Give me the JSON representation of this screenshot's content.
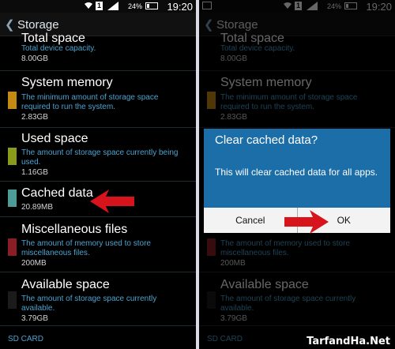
{
  "status": {
    "battery_pct": "24%",
    "time": "19:20",
    "sim": "1"
  },
  "actionbar": {
    "title": "Storage"
  },
  "items": [
    {
      "title": "Total space",
      "desc": "Total device capacity.",
      "value": "8.00GB",
      "color": ""
    },
    {
      "title": "System memory",
      "desc": "The minimum amount of storage space required to run the system.",
      "value": "2.83GB",
      "color": "#c58a12"
    },
    {
      "title": "Used space",
      "desc": "The amount of storage space currently being used.",
      "value": "1.16GB",
      "color": "#8a9a1b"
    },
    {
      "title": "Cached data",
      "desc": "",
      "value": "20.89MB",
      "color": "#4d9c97"
    },
    {
      "title": "Miscellaneous files",
      "desc": "The amount of memory used to store miscellaneous files.",
      "value": "200MB",
      "color": "#8a1e24"
    },
    {
      "title": "Available space",
      "desc": "The amount of storage space currently available.",
      "value": "3.79GB",
      "color": "#1b1b1b"
    }
  ],
  "sd_card_label": "SD CARD",
  "dialog": {
    "title": "Clear cached data?",
    "message": "This will clear cached data for all apps.",
    "cancel": "Cancel",
    "ok": "OK"
  },
  "watermark": "TarfandHa.Net"
}
